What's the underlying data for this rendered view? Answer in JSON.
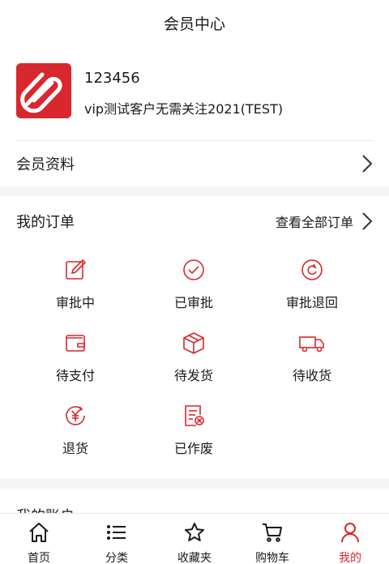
{
  "header": {
    "title": "会员中心"
  },
  "profile": {
    "username": "123456",
    "subtitle": "vip测试客户无需关注2021(TEST)",
    "member_info_label": "会员资料"
  },
  "orders": {
    "title": "我的订单",
    "view_all": "查看全部订单",
    "items": [
      {
        "label": "审批中",
        "icon": "edit-icon"
      },
      {
        "label": "已审批",
        "icon": "check-circle-icon"
      },
      {
        "label": "审批退回",
        "icon": "return-circle-icon"
      },
      {
        "label": "待支付",
        "icon": "wallet-icon"
      },
      {
        "label": "待发货",
        "icon": "package-icon"
      },
      {
        "label": "待收货",
        "icon": "truck-icon"
      },
      {
        "label": "退货",
        "icon": "yen-refund-icon"
      },
      {
        "label": "已作废",
        "icon": "cancelled-doc-icon"
      }
    ]
  },
  "next_section": {
    "title": "我的账户"
  },
  "tabbar": {
    "items": [
      {
        "label": "首页",
        "icon": "home-icon"
      },
      {
        "label": "分类",
        "icon": "list-icon"
      },
      {
        "label": "收藏夹",
        "icon": "star-icon"
      },
      {
        "label": "购物车",
        "icon": "cart-icon"
      },
      {
        "label": "我的",
        "icon": "user-icon",
        "active": true
      }
    ]
  },
  "colors": {
    "accent": "#d9272e",
    "background": "#f4f5f7"
  }
}
